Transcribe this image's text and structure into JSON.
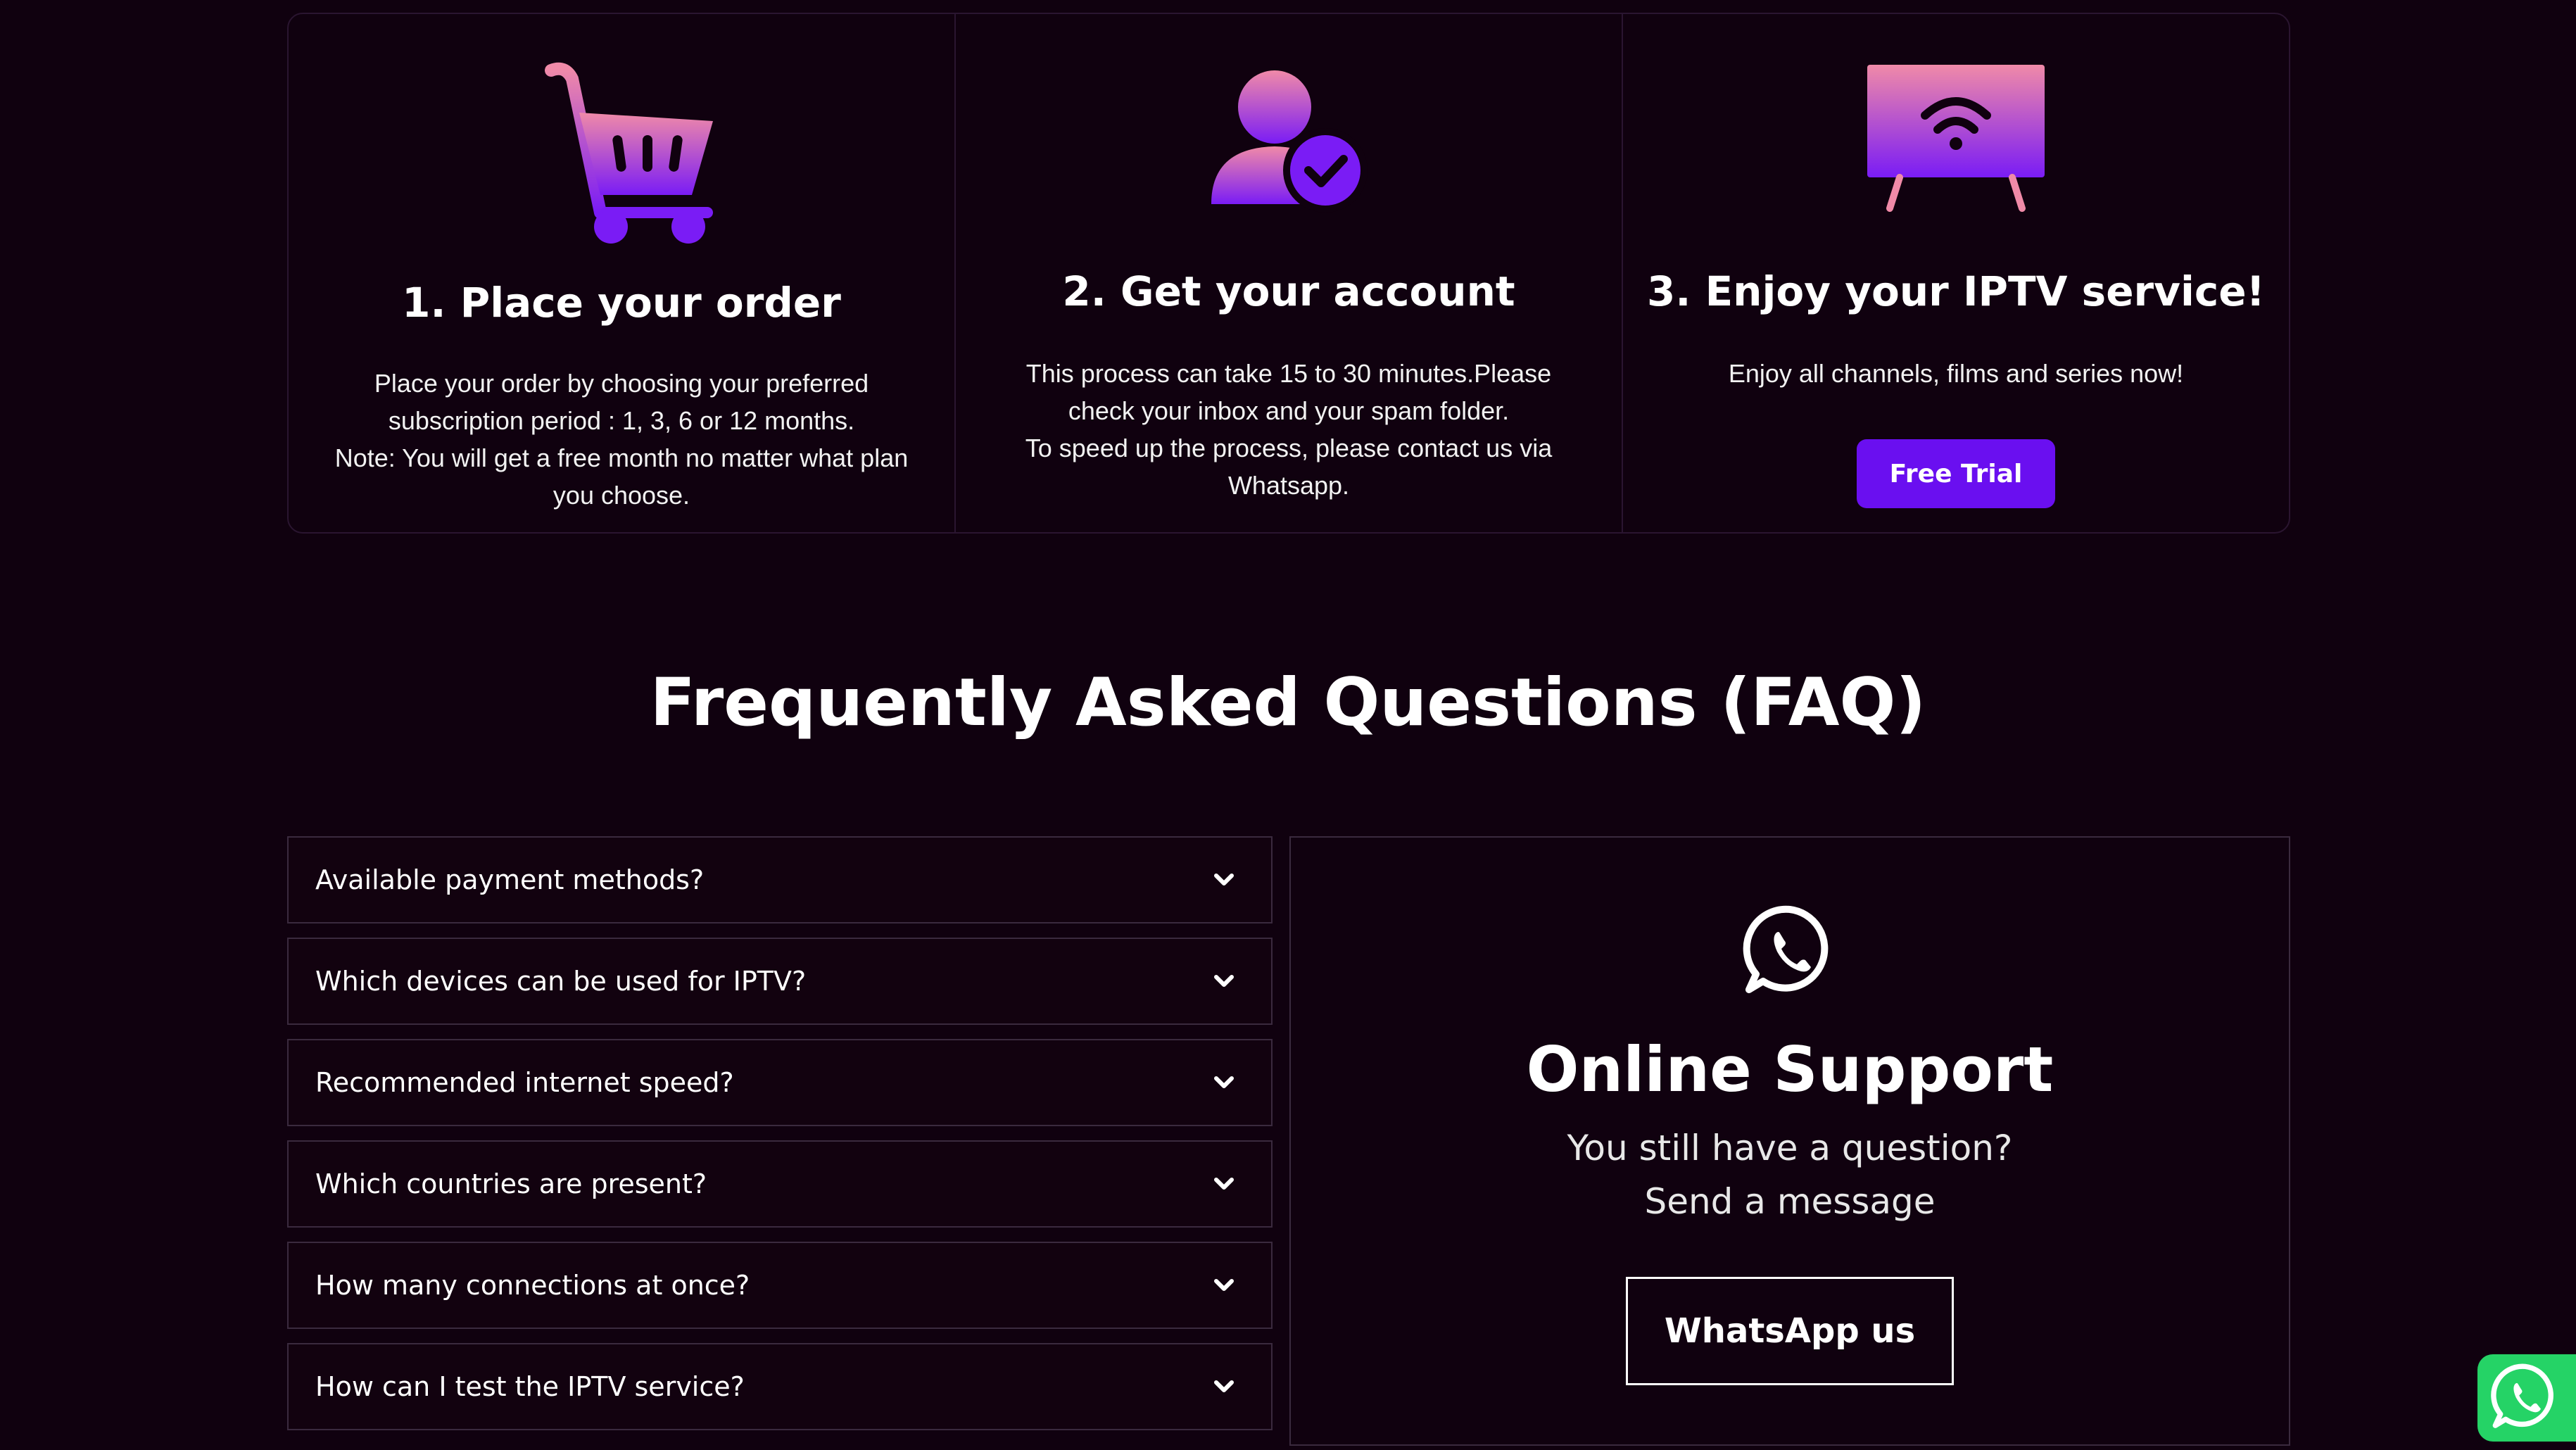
{
  "steps": [
    {
      "title": "1. Place your order",
      "lines": [
        "Place your order by choosing your preferred",
        "subscription period : 1, 3, 6 or 12 months.",
        "Note: You will get a free month no matter what plan",
        "you choose."
      ],
      "icon": "shopping-cart-icon"
    },
    {
      "title": "2. Get your account",
      "lines": [
        "This process can take 15 to 30 minutes.Please",
        "check your inbox and your spam folder.",
        "To speed up the process, please contact us via",
        "Whatsapp."
      ],
      "icon": "user-check-icon"
    },
    {
      "title": "3. Enjoy your IPTV service!",
      "lines": [
        "Enjoy all channels, films and series now!"
      ],
      "icon": "tv-wifi-icon",
      "button": "Free Trial"
    }
  ],
  "faq": {
    "title": "Frequently Asked Questions (FAQ)",
    "items": [
      "Available payment methods?",
      "Which devices can be used for IPTV?",
      "Recommended internet speed?",
      "Which countries are present?",
      "How many connections at once?",
      "How can I test the IPTV service?"
    ]
  },
  "support": {
    "title": "Online Support",
    "line1": "You still have a question?",
    "line2": "Send a message",
    "button": "WhatsApp us",
    "icon": "whatsapp-icon"
  },
  "floating": {
    "icon": "whatsapp-icon"
  },
  "colors": {
    "background": "#10010f",
    "accent": "#6a0ff0",
    "gradient_top": "#f08aa8",
    "gradient_bottom": "#7a1cf5",
    "whatsapp": "#25d366"
  }
}
